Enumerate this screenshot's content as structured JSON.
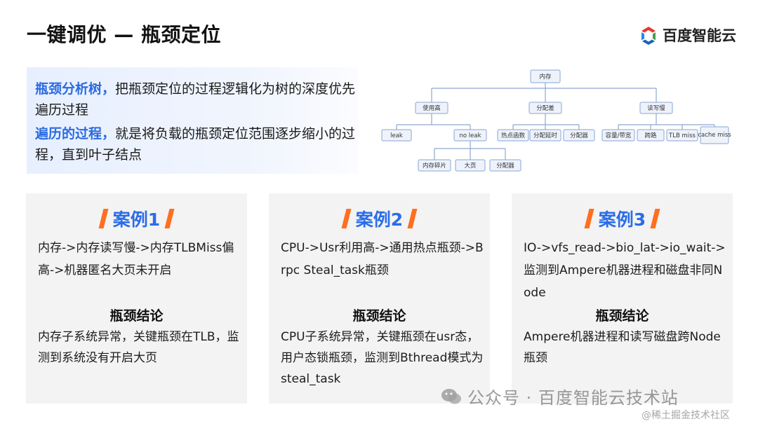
{
  "page": {
    "title": "一键调优 — 瓶颈定位",
    "logo_text": "百度智能云"
  },
  "intro": {
    "line1_highlight": "瓶颈分析树，",
    "line1_text": "把瓶颈定位的过程逻辑化为树的深度优先遍历过程",
    "line2_highlight": "遍历的过程，",
    "line2_text": "就是将负载的瓶颈定位范围逐步缩小的过程，直到叶子结点"
  },
  "tree": {
    "root": "内存",
    "level1": [
      "使用高",
      "分配差",
      "读写慢"
    ],
    "usage_children": [
      "leak",
      "no leak"
    ],
    "alloc_children": [
      "热点函数",
      "分配延时",
      "分配器"
    ],
    "rw_children": [
      "容量/带宽",
      "跨路",
      "TLB miss",
      "cache miss"
    ],
    "noleak_children": [
      "内存碎片",
      "大页",
      "分配器"
    ]
  },
  "cases": [
    {
      "title": "案例1",
      "path": "内存->内存读写慢->内存TLBMiss偏高->机器匿名大页未开启",
      "conclusion_title": "瓶颈结论",
      "conclusion": "内存子系统异常，关键瓶颈在TLB，监测到系统没有开启大页"
    },
    {
      "title": "案例2",
      "path": "CPU->Usr利用高->通用热点瓶颈->Brpc Steal_task瓶颈",
      "conclusion_title": "瓶颈结论",
      "conclusion": "CPU子系统异常，关键瓶颈在usr态，用户态锁瓶颈，监测到Bthread模式为steal_task"
    },
    {
      "title": "案例3",
      "path": "IO->vfs_read->bio_lat->io_wait->监测到Ampere机器进程和磁盘非同Node",
      "conclusion_title": "瓶颈结论",
      "conclusion": "Ampere机器进程和读写磁盘跨Node瓶颈"
    }
  ],
  "watermark": {
    "text": "公众号 · 百度智能云技术站",
    "site": "@稀土掘金技术社区"
  },
  "colors": {
    "accent_blue": "#2b6de8",
    "accent_orange": "#ff6f1f",
    "node_fill": "#eef3fb",
    "node_stroke": "#8aa6d4",
    "edge": "#8fa8cf"
  }
}
